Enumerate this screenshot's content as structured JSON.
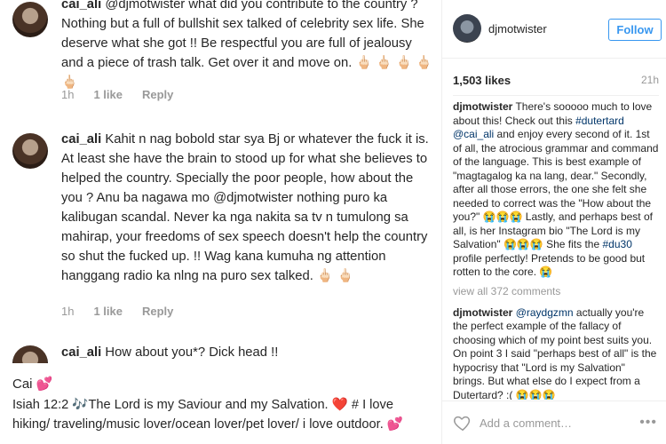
{
  "comments": [
    {
      "user": "cai_ali",
      "text": "@djmotwister  what did you contribute to the country ? Nothing but a full of bullshit sex talked of celebrity sex life. She deserve what she got !! Be respectful you are full of  jealousy and a piece of trash talk. Get over it and move on. 🖕🏻 🖕🏻 🖕🏻 🖕🏻 🖕🏻",
      "time": "1h",
      "likes": "1 like",
      "reply": "Reply"
    },
    {
      "user": "cai_ali",
      "text": "Kahit n nag bobold star sya Bj or whatever the fuck it is. At least she have the brain to stood up for what she believes to helped the country. Specially the poor people, how about the you ? Anu ba nagawa mo @djmotwister  nothing puro ka kalibugan scandal. Never ka nga nakita sa tv n tumulong sa mahirap, your freedoms of sex speech doesn't help the country so shut the fucked up. !! Wag kana kumuha ng attention hanggang radio ka nlng na puro sex talked. 🖕🏻 🖕🏻",
      "time": "1h",
      "likes": "1 like",
      "reply": "Reply"
    },
    {
      "user": "cai_ali",
      "text": "How about you*? Dick head !!"
    }
  ],
  "bio": {
    "name": "Cai 💕",
    "text_a": "Isiah 12:2 🎶The Lord is my Saviour and my Salvation. ",
    "heart": "❤️",
    "text_b": "  # I love hiking/ traveling/music lover/ocean lover/pet lover/ i love outdoor. ",
    "end_heart": "💕"
  },
  "post": {
    "username": "djmotwister",
    "follow_label": "Follow",
    "likes": "1,503 likes",
    "time": "21h",
    "caption_user": "djmotwister",
    "caption_a": " There's sooooo much to love about this! Check out this ",
    "caption_tag1": "#dutertard",
    "caption_b": " ",
    "caption_tag2": "@cai_ali",
    "caption_c": " and enjoy every second of it. 1st of all, the atrocious grammar and command of the language. This is best example of \"magtagalog ka na lang, dear.\" Secondly, after all those errors, the one she felt she needed to correct was the \"How about the you?\" 😭😭😭 Lastly, and perhaps best of all, is her Instagram bio \"The Lord is my Salvation\" 😭😭😭 She fits the ",
    "caption_tag3": "#du30",
    "caption_d": " profile perfectly! Pretends to be good but rotten to the core. 😭",
    "view_all": "view all 372 comments",
    "reply_user": "djmotwister",
    "reply_tag": "@raydgzmn",
    "reply_text": " actually you're the perfect example of the fallacy of choosing which of my point best suits you. On point 3 I said \"perhaps best of all\" is the hypocrisy that \"Lord is my Salvation\" brings. But what else do I expect from a Dutertard? :( 😭😭😭",
    "add_comment_placeholder": "Add a comment…",
    "more": "•••"
  }
}
